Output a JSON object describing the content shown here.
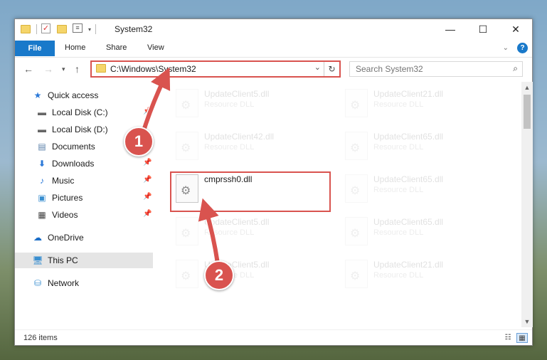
{
  "window": {
    "title": "System32",
    "controls": {
      "minimize": "—",
      "maximize": "☐",
      "close": "✕"
    }
  },
  "ribbon": {
    "tabs": [
      {
        "label": "File"
      },
      {
        "label": "Home"
      },
      {
        "label": "Share"
      },
      {
        "label": "View"
      }
    ]
  },
  "address": {
    "path": "C:\\Windows\\System32",
    "search_placeholder": "Search System32"
  },
  "sidebar": {
    "items": [
      {
        "label": "Quick access",
        "icon": "star-icon",
        "pinned": false
      },
      {
        "label": "Local Disk (C:)",
        "icon": "drive-icon",
        "pinned": true
      },
      {
        "label": "Local Disk (D:)",
        "icon": "drive-icon",
        "pinned": false
      },
      {
        "label": "Documents",
        "icon": "documents-icon",
        "pinned": true
      },
      {
        "label": "Downloads",
        "icon": "download-icon",
        "pinned": true
      },
      {
        "label": "Music",
        "icon": "music-icon",
        "pinned": true
      },
      {
        "label": "Pictures",
        "icon": "pictures-icon",
        "pinned": true
      },
      {
        "label": "Videos",
        "icon": "videos-icon",
        "pinned": true
      },
      {
        "label": "OneDrive",
        "icon": "cloud-icon",
        "pinned": false
      },
      {
        "label": "This PC",
        "icon": "computer-icon",
        "pinned": false,
        "selected": true
      },
      {
        "label": "Network",
        "icon": "network-icon",
        "pinned": false
      }
    ]
  },
  "files": [
    {
      "name": "UpdateClient5.dll",
      "type": "Resource DLL",
      "faded": true
    },
    {
      "name": "UpdateClient21.dll",
      "type": "Resource DLL",
      "faded": true
    },
    {
      "name": "UpdateClient42.dll",
      "type": "Resource DLL",
      "faded": true
    },
    {
      "name": "UpdateClient65.dll",
      "type": "Resource DLL",
      "faded": true
    },
    {
      "name": "cmprssh0.dll",
      "type": "",
      "faded": false
    },
    {
      "name": "UpdateClient65.dll",
      "type": "Resource DLL",
      "faded": true
    },
    {
      "name": "UpdateClient5.dll",
      "type": "Resource DLL",
      "faded": true
    },
    {
      "name": "UpdateClient65.dll",
      "type": "Resource DLL",
      "faded": true
    },
    {
      "name": "UpdateClient5.dll",
      "type": "Resource DLL",
      "faded": true
    },
    {
      "name": "UpdateClient21.dll",
      "type": "Resource DLL",
      "faded": true
    }
  ],
  "status": {
    "item_count": "126 items"
  },
  "annotations": {
    "step1": "1",
    "step2": "2",
    "color": "#d9534f"
  }
}
